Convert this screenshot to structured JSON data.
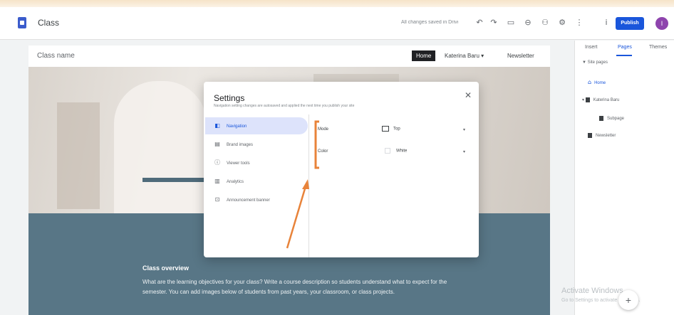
{
  "app": {
    "title": "Class",
    "saved_status": "All changes saved in Drive"
  },
  "toolbar": {
    "publish_label": "Publish",
    "avatar_letter": "I"
  },
  "site": {
    "name": "Class name",
    "nav": {
      "home": "Home",
      "item2": "Katerina Baru",
      "item3": "Newsletter"
    }
  },
  "overview": {
    "title": "Class overview",
    "body": "What are the learning objectives for your class? Write a course description so students understand what to expect for the semester. You can add images below of students from past years, your classroom, or class projects."
  },
  "sidepanel": {
    "tabs": [
      "Insert",
      "Pages",
      "Themes"
    ],
    "active_tab": "Pages",
    "section": "Site pages",
    "pages": [
      "Home",
      "Katerina Baru",
      "Subpage",
      "Newsletter"
    ]
  },
  "settings": {
    "title": "Settings",
    "subtitle": "Navigation setting changes are autosaved and applied the next time you publish your site",
    "nav": [
      "Navigation",
      "Brand images",
      "Viewer tools",
      "Analytics",
      "Announcement banner"
    ],
    "active": "Navigation",
    "fields": {
      "mode_label": "Mode",
      "mode_value": "Top",
      "color_label": "Color",
      "color_value": "White"
    }
  },
  "watermark": {
    "line1": "Activate Windows",
    "line2": "Go to Settings to activate Windows."
  },
  "colors": {
    "accent": "#1a56db",
    "overview_bg": "#587686",
    "annotation": "#e8833a"
  }
}
